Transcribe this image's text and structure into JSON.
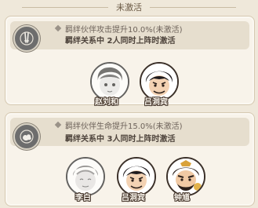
{
  "header": {
    "title": "未激活"
  },
  "bonds": [
    {
      "line1": "羁绊伙伴攻击提升10.0%(未激活)",
      "line2": "羁绊关系中 2人同时上阵时激活",
      "icon": "sword-emblem-icon",
      "partners": [
        {
          "name": "赵刘和",
          "active": false
        },
        {
          "name": "吕洞宾",
          "active": true
        }
      ]
    },
    {
      "line1": "羁绊伙伴生命提升15.0%(未激活)",
      "line2": "羁绊关系中 3人同时上阵时激活",
      "icon": "cloud-emblem-icon",
      "partners": [
        {
          "name": "李白",
          "active": false
        },
        {
          "name": "吕洞宾",
          "active": true
        },
        {
          "name": "钟馗",
          "active": true
        }
      ]
    }
  ],
  "colors": {
    "background": "#efe8da",
    "card": "#f8f3ea",
    "text_dim": "#6d625a",
    "text_main": "#4e443c"
  }
}
